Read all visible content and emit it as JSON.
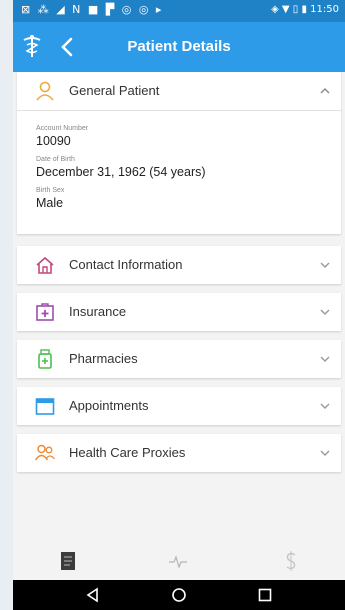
{
  "status_bar": {
    "left_icons": [
      "notification-icons"
    ],
    "time": "11:50"
  },
  "app_bar": {
    "title": "Patient Details"
  },
  "general_patient": {
    "label": "General Patient",
    "account_caption": "Account Number",
    "account_number": "10090",
    "dob_caption": "Date of Birth",
    "dob": "December 31, 1962 (54 years)",
    "sex_caption": "Birth Sex",
    "sex": "Male"
  },
  "sections": [
    {
      "label": "Contact Information",
      "icon": "house-icon"
    },
    {
      "label": "Insurance",
      "icon": "medical-kit-icon"
    },
    {
      "label": "Pharmacies",
      "icon": "pill-bottle-icon"
    },
    {
      "label": "Appointments",
      "icon": "calendar-icon"
    },
    {
      "label": "Health Care Proxies",
      "icon": "people-icon"
    }
  ],
  "colors": {
    "status_bar": "#1f82c6",
    "app_bar": "#2d9be8",
    "general_icon": "#f2a93b",
    "contact_icon": "#c2497d",
    "insurance_icon": "#a04bb0",
    "pharmacy_icon": "#4bbf4f",
    "appointments_icon": "#2d9be8",
    "proxies_icon": "#f08a33"
  }
}
